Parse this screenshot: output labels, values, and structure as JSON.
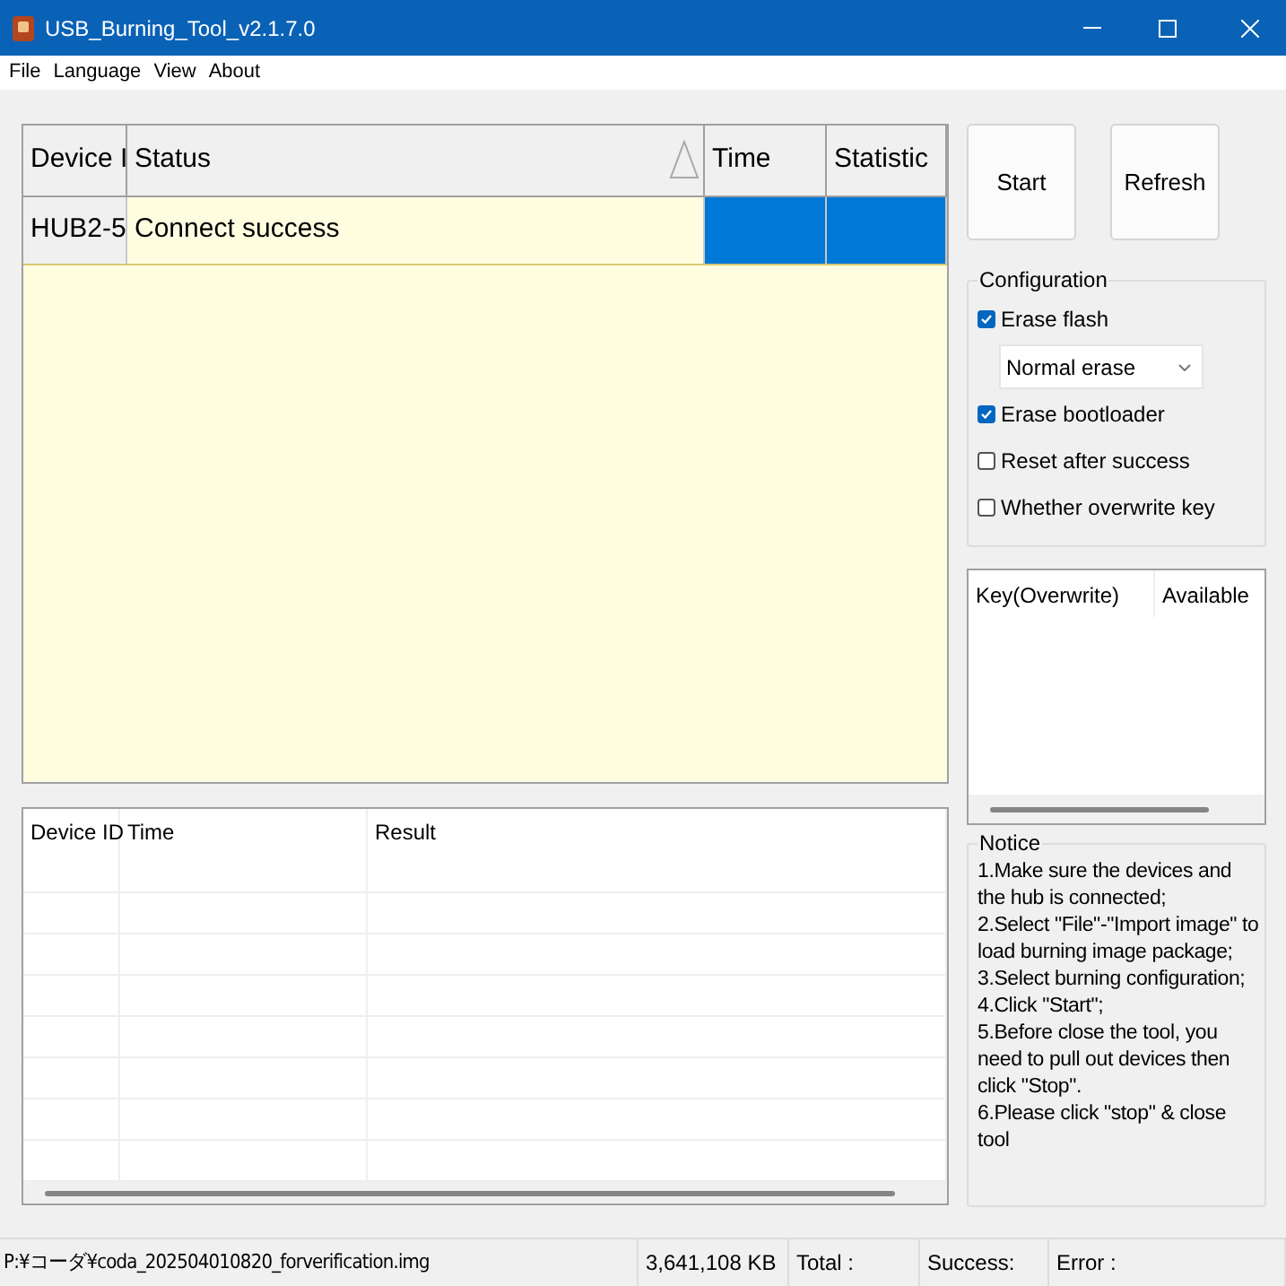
{
  "window": {
    "title": "USB_Burning_Tool_v2.1.7.0"
  },
  "menu": [
    "File",
    "Language",
    "View",
    "About"
  ],
  "device_table": {
    "columns": [
      {
        "label": "Device I",
        "sorted": false
      },
      {
        "label": "Status",
        "sorted": true
      },
      {
        "label": "Time",
        "sorted": false
      },
      {
        "label": "Statistic",
        "sorted": false
      }
    ],
    "rows": [
      {
        "cells": [
          "HUB2-5",
          "Connect success"
        ],
        "selected": true
      }
    ]
  },
  "buttons": [
    "Start",
    "Refresh"
  ],
  "configuration": {
    "title": "Configuration",
    "options": [
      {
        "kind": "checkbox",
        "label": "Erase flash",
        "checked": true
      },
      {
        "kind": "dropdown",
        "value": "Normal erase"
      },
      {
        "kind": "checkbox",
        "label": "Erase bootloader",
        "checked": true
      },
      {
        "kind": "checkbox",
        "label": "Reset after success",
        "checked": false
      },
      {
        "kind": "checkbox",
        "label": "Whether overwrite key",
        "checked": false
      }
    ]
  },
  "key_list": {
    "columns": [
      "Key(Overwrite)",
      "Available"
    ]
  },
  "result_table": {
    "columns": [
      "Device ID",
      "Time",
      "Result"
    ]
  },
  "notice": {
    "title": "Notice",
    "lines": [
      "1.Make sure the devices and the hub is connected;",
      "2.Select \"File\"-\"Import image\" to load burning image package;",
      "3.Select burning configuration;",
      "4.Click \"Start\";",
      "5.Before close the tool, you need to pull out devices then click \"Stop\".",
      "6.Please click \"stop\" & close tool"
    ]
  },
  "status_bar": [
    "P:¥コーダ¥coda_202504010820_forverification.img",
    "3,641,108 KB",
    "Total :",
    "Success:",
    "Error :"
  ]
}
